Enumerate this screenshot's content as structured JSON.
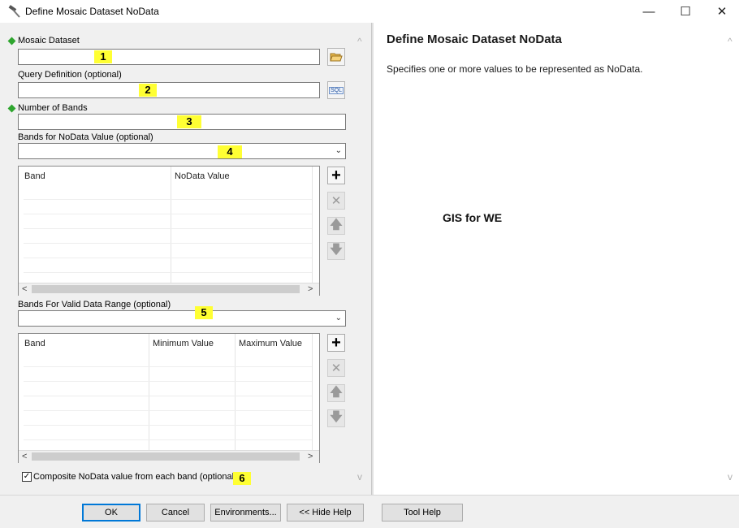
{
  "window": {
    "title": "Define Mosaic Dataset NoData",
    "minimize_glyph": "—",
    "maximize_glyph": "☐",
    "close_glyph": "✕"
  },
  "form": {
    "mosaic_dataset": {
      "label": "Mosaic Dataset",
      "value": "",
      "marker": "1",
      "icon": "folder-open-icon"
    },
    "query_definition": {
      "label": "Query Definition (optional)",
      "value": "",
      "marker": "2",
      "icon_text": "SQL"
    },
    "number_of_bands": {
      "label": "Number of Bands",
      "value": "",
      "marker": "3"
    },
    "bands_nodata": {
      "label": "Bands for NoData Value (optional)",
      "value": "",
      "marker": "4"
    },
    "nodata_table": {
      "columns": [
        "Band",
        "NoData Value"
      ]
    },
    "bands_valid_range": {
      "label": "Bands For Valid Data Range (optional)",
      "value": "",
      "marker": "5"
    },
    "range_table": {
      "columns": [
        "Band",
        "Minimum Value",
        "Maximum Value"
      ]
    },
    "composite": {
      "label": "Composite NoData value from each band (optional)",
      "checked": true,
      "check_glyph": "✓",
      "marker": "6"
    }
  },
  "table_buttons": {
    "add": "+",
    "remove": "✕",
    "up": "🡅",
    "down": "🡇"
  },
  "scroll": {
    "left": "<",
    "right": ">",
    "up": "^",
    "down": "v"
  },
  "help": {
    "title": "Define Mosaic Dataset NoData",
    "description": "Specifies one or more values to be represented as NoData.",
    "watermark": "GIS for WE"
  },
  "buttons": {
    "ok": "OK",
    "cancel": "Cancel",
    "environments": "Environments...",
    "hide_help": "<< Hide Help",
    "tool_help": "Tool Help"
  },
  "colors": {
    "required": "#2ea52e",
    "highlight": "#ffff33",
    "accent": "#0078d7"
  }
}
